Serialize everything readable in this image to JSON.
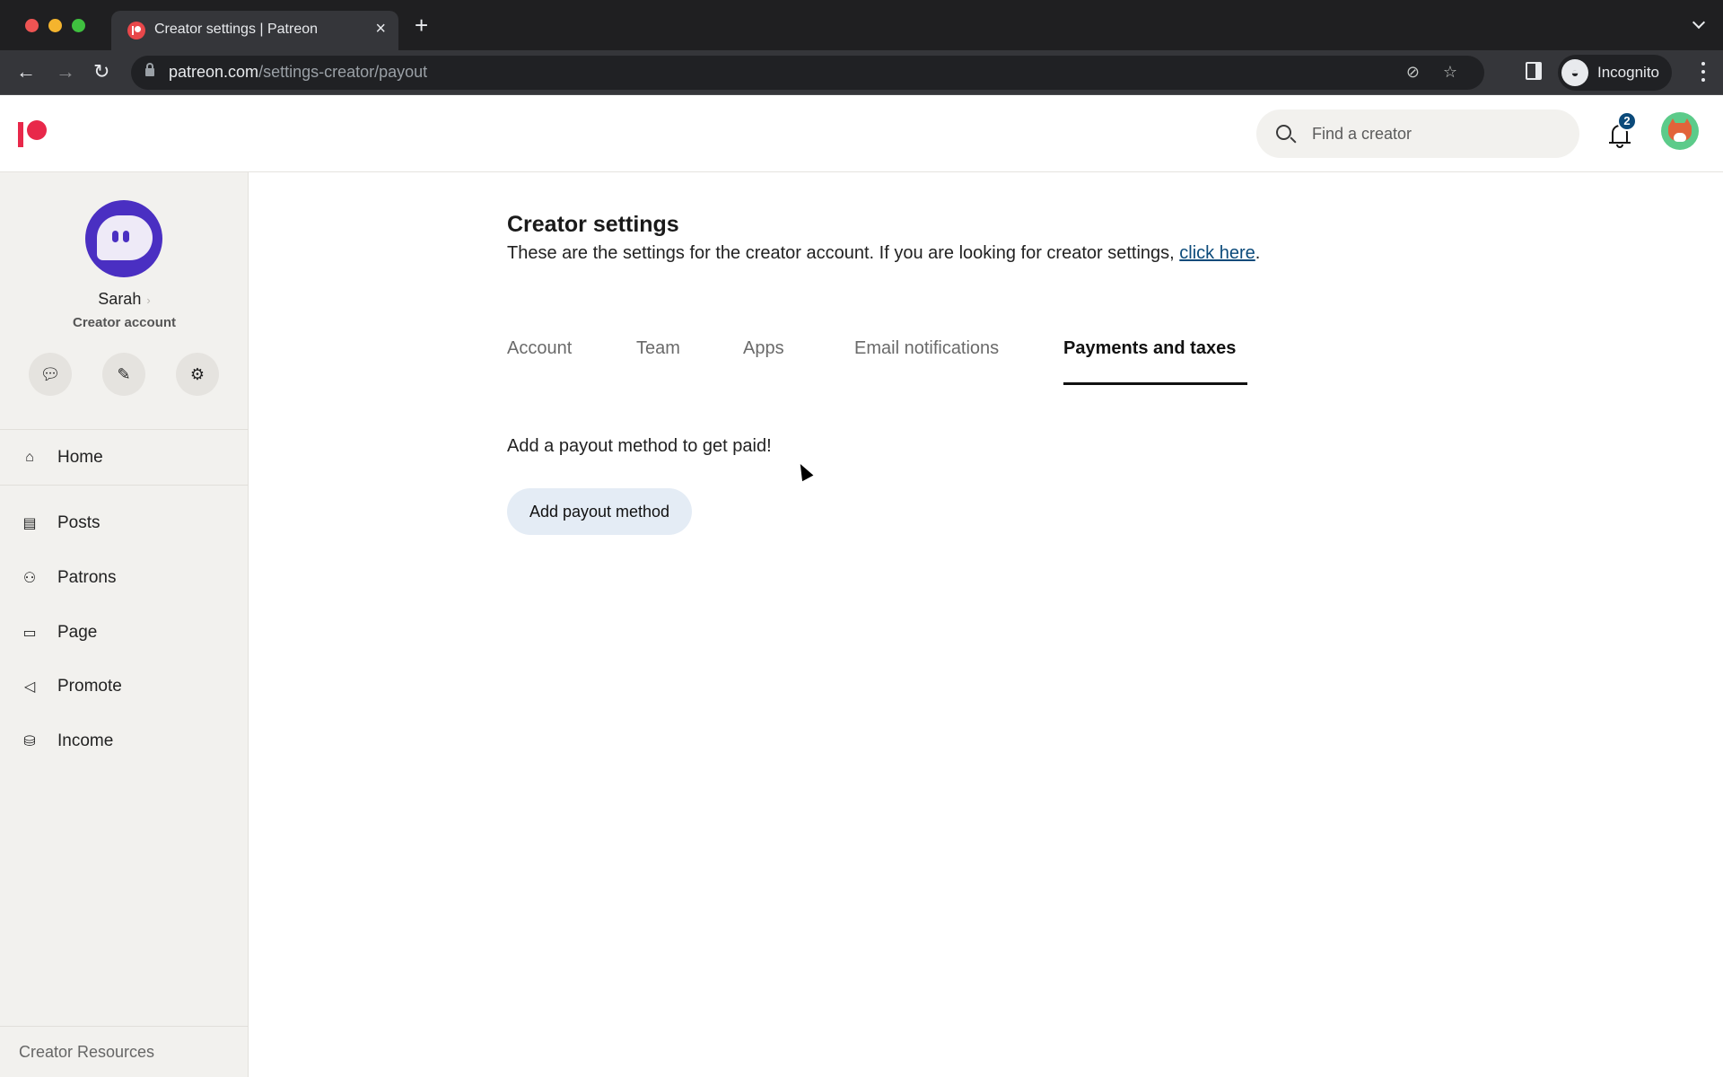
{
  "browser": {
    "tab_title": "Creator settings | Patreon",
    "url_host": "patreon.com",
    "url_path": "/settings-creator/payout",
    "profile_label": "Incognito",
    "icons": [
      "back-icon",
      "forward-icon",
      "reload-icon",
      "lock-icon",
      "eye-off-icon",
      "star-icon",
      "side-panel-icon",
      "incognito-icon",
      "kebab-menu-icon"
    ]
  },
  "header": {
    "search_placeholder": "Find a creator",
    "notification_count": "2"
  },
  "sidebar": {
    "profile_name": "Sarah",
    "profile_role": "Creator account",
    "quick_actions": [
      {
        "name": "messages",
        "icon": "chat-bubbles-icon"
      },
      {
        "name": "edit",
        "icon": "edit-icon"
      },
      {
        "name": "settings",
        "icon": "gear-icon"
      }
    ],
    "items": [
      {
        "label": "Home",
        "icon": "home-icon"
      },
      {
        "label": "Posts",
        "icon": "posts-icon"
      },
      {
        "label": "Patrons",
        "icon": "patrons-icon"
      },
      {
        "label": "Page",
        "icon": "page-icon"
      },
      {
        "label": "Promote",
        "icon": "megaphone-icon"
      },
      {
        "label": "Income",
        "icon": "coins-icon"
      }
    ],
    "footer_link": "Creator Resources"
  },
  "main": {
    "title": "Creator settings",
    "subtitle_text": "These are the settings for the creator account. If you are looking for creator settings, ",
    "subtitle_link": "click here",
    "subtitle_end": ".",
    "tabs": [
      {
        "label": "Account",
        "active": false
      },
      {
        "label": "Team",
        "active": false
      },
      {
        "label": "Apps",
        "active": false
      },
      {
        "label": "Email notifications",
        "active": false
      },
      {
        "label": "Payments and taxes",
        "active": true
      }
    ],
    "payout_message": "Add a payout method to get paid!",
    "payout_button": "Add payout method"
  },
  "colors": {
    "brand": "#e8284a",
    "link": "#0b4a7a",
    "badge": "#0b4a7a",
    "button_bg": "#e4ecf5"
  }
}
